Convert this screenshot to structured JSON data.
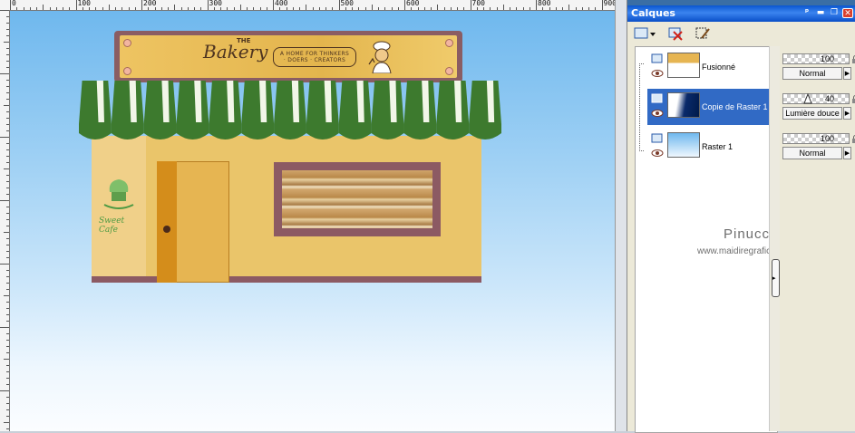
{
  "ruler": {
    "labels": [
      "0",
      "100",
      "200",
      "300",
      "400",
      "500",
      "600",
      "700",
      "800",
      "900"
    ]
  },
  "canvas": {
    "bakery": {
      "sign_title": "Bakery",
      "sign_title_prefix": "THE",
      "sign_tagline": "A HOME FOR THINKERS · DOERS · CREATORS",
      "cafe_sign": "Sweet Cafe"
    }
  },
  "layers_panel": {
    "title": "Calques",
    "window_buttons": [
      "pin",
      "minimize",
      "restore",
      "close"
    ],
    "toolbar_icons": [
      "new-layer-icon",
      "delete-layer-icon",
      "edit-layer-icon"
    ],
    "layers": [
      {
        "name": "Fusionné",
        "opacity": "100",
        "blend": "Normal",
        "selected": false
      },
      {
        "name": "Copie de Raster 1",
        "opacity": "40",
        "blend": "Lumière douce",
        "selected": true
      },
      {
        "name": "Raster 1",
        "opacity": "100",
        "blend": "Normal",
        "selected": false
      }
    ],
    "watermark_name": "Pinuccia",
    "watermark_url": "www.maidiregrafica.eu"
  },
  "colors": {
    "titlebar": "#0a56d0",
    "selected_layer": "#316ac5",
    "awning_green": "#3d7a2e",
    "awning_white": "#f2f6e8",
    "building": "#eac56a"
  }
}
